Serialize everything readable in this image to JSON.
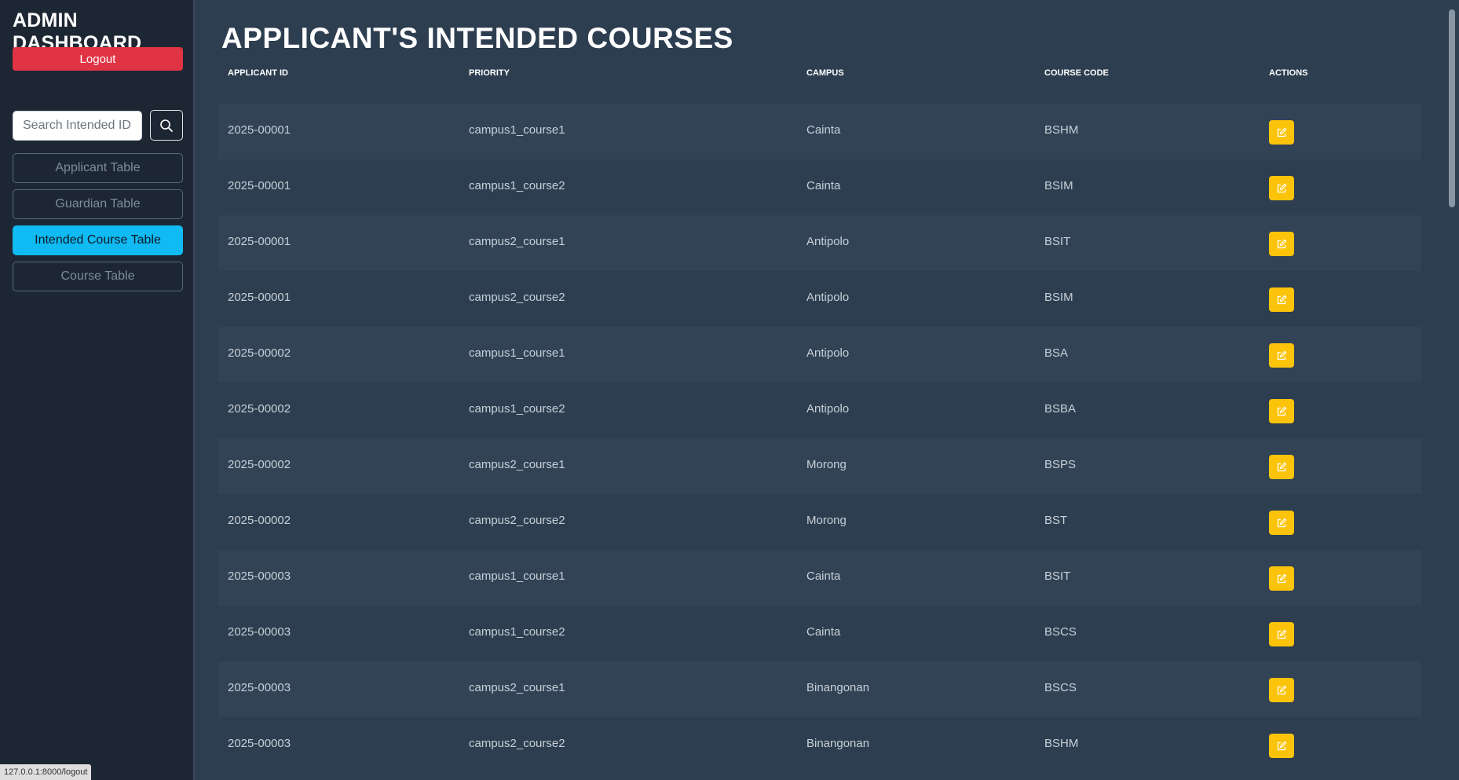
{
  "sidebar": {
    "brand": "ADMIN DASHBOARD",
    "logout_label": "Logout",
    "search_placeholder": "Search Intended ID...",
    "nav": [
      {
        "label": "Applicant Table",
        "active": false
      },
      {
        "label": "Guardian Table",
        "active": false
      },
      {
        "label": "Intended Course Table",
        "active": true
      },
      {
        "label": "Course Table",
        "active": false
      }
    ]
  },
  "main": {
    "title": "APPLICANT'S INTENDED COURSES",
    "columns": [
      "APPLICANT ID",
      "PRIORITY",
      "CAMPUS",
      "COURSE CODE",
      "ACTIONS"
    ],
    "rows": [
      {
        "applicant_id": "2025-00001",
        "priority": "campus1_course1",
        "campus": "Cainta",
        "course_code": "BSHM"
      },
      {
        "applicant_id": "2025-00001",
        "priority": "campus1_course2",
        "campus": "Cainta",
        "course_code": "BSIM"
      },
      {
        "applicant_id": "2025-00001",
        "priority": "campus2_course1",
        "campus": "Antipolo",
        "course_code": "BSIT"
      },
      {
        "applicant_id": "2025-00001",
        "priority": "campus2_course2",
        "campus": "Antipolo",
        "course_code": "BSIM"
      },
      {
        "applicant_id": "2025-00002",
        "priority": "campus1_course1",
        "campus": "Antipolo",
        "course_code": "BSA"
      },
      {
        "applicant_id": "2025-00002",
        "priority": "campus1_course2",
        "campus": "Antipolo",
        "course_code": "BSBA"
      },
      {
        "applicant_id": "2025-00002",
        "priority": "campus2_course1",
        "campus": "Morong",
        "course_code": "BSPS"
      },
      {
        "applicant_id": "2025-00002",
        "priority": "campus2_course2",
        "campus": "Morong",
        "course_code": "BST"
      },
      {
        "applicant_id": "2025-00003",
        "priority": "campus1_course1",
        "campus": "Cainta",
        "course_code": "BSIT"
      },
      {
        "applicant_id": "2025-00003",
        "priority": "campus1_course2",
        "campus": "Cainta",
        "course_code": "BSCS"
      },
      {
        "applicant_id": "2025-00003",
        "priority": "campus2_course1",
        "campus": "Binangonan",
        "course_code": "BSCS"
      },
      {
        "applicant_id": "2025-00003",
        "priority": "campus2_course2",
        "campus": "Binangonan",
        "course_code": "BSHM"
      }
    ]
  },
  "status_bar": {
    "url": "127.0.0.1:8000/logout"
  },
  "colors": {
    "logout": "#e03444",
    "active_nav": "#10baf2",
    "edit_button": "#fbc30a",
    "background": "#2d3e50",
    "sidebar": "#1d2733"
  },
  "icons": {
    "search": "search-icon",
    "edit": "edit-icon"
  }
}
